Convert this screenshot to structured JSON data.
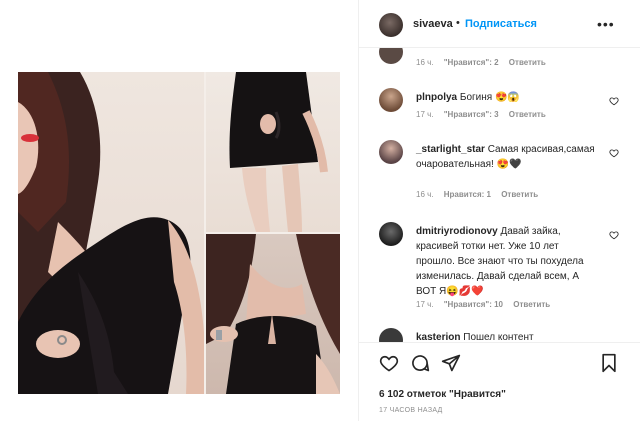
{
  "header": {
    "username": "sivaeva",
    "dot": "•",
    "follow_label": "Подписаться",
    "more_label": "•••"
  },
  "comments": [
    {
      "username": "",
      "text": "",
      "time": "16 ч.",
      "likes": "\"Нравится\": 2",
      "reply_label": "Ответить",
      "avatar_color": "#5a4a44"
    },
    {
      "username": "plnpolya",
      "text": "Богиня 😍😱",
      "time": "17 ч.",
      "likes": "\"Нравится\": 3",
      "reply_label": "Ответить",
      "avatar_color": "#8a6b52"
    },
    {
      "username": "_starlight_star",
      "text": "Самая красивая,самая очаровательная! 😍🖤",
      "time": "16 ч.",
      "likes": "Нравится: 1",
      "reply_label": "Ответить",
      "avatar_color": "#6d5a58"
    },
    {
      "username": "dmitriyrodionovy",
      "text": "Давай зайка, красивей тотки нет. Уже 10 лет прошло. Все знают что ты похудела изменилась. Давай сделай всем, А ВОТ Я😝💋❤️",
      "time": "17 ч.",
      "likes": "\"Нравится\": 10",
      "reply_label": "Ответить",
      "avatar_color": "#2f2f2f"
    },
    {
      "username": "kasterion",
      "text": "Пошел контент",
      "avatar_color": "#3a3a3a"
    }
  ],
  "footer": {
    "likes_count": "6 102 отметок \"Нравится\"",
    "time_ago": "17 часов назад"
  },
  "icons": {
    "like": "heart-icon",
    "comment": "comment-icon",
    "share": "paper-plane-icon",
    "save": "bookmark-icon"
  },
  "colors": {
    "accent": "#0095f6",
    "text": "#262626",
    "muted": "#8e8e8e"
  }
}
